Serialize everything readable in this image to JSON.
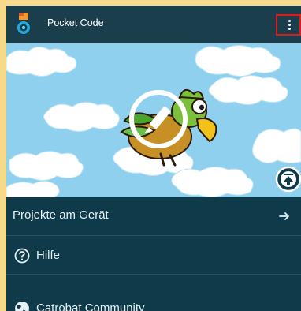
{
  "app": {
    "title": "Pocket Code",
    "icon": "pocket-code-logo-icon"
  },
  "toolbar": {
    "overflow_icon": "overflow-menu-icon"
  },
  "hero": {
    "edit_icon": "pencil-edit-icon",
    "upload_icon": "upload-icon"
  },
  "menu": {
    "items": [
      {
        "label": "Projekte am Gerät",
        "icon": "arrow-right-icon"
      },
      {
        "label": "Hilfe",
        "icon": "question-circle-icon"
      },
      {
        "label": "Catrobat Community",
        "icon": "globe-icon"
      }
    ]
  },
  "colors": {
    "toolbar": "#1a3e4b",
    "menu_bg": "#0f3a49",
    "sky": "#8fd0ef",
    "highlight": "#e01a1a",
    "outer": "#f6d98a"
  }
}
